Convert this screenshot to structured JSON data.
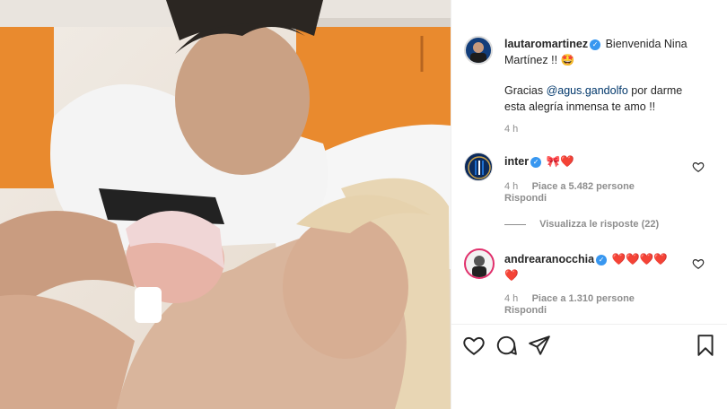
{
  "post": {
    "author": "lautaromartinez",
    "caption_line1": "Bienvenida Nina",
    "caption_line2": "Martínez !!",
    "caption_emoji": "🤩",
    "thanks_prefix": "Gracias",
    "mention": "@agus.gandolfo",
    "thanks_suffix": "por darme",
    "thanks_line2": "esta alegría inmensa te amo !!",
    "time": "4 h"
  },
  "comments": [
    {
      "username": "inter",
      "text": "🎀❤️",
      "time": "4 h",
      "likes": "Piace a 5.482 persone",
      "reply": "Rispondi",
      "view_replies": "Visualizza le risposte (22)"
    },
    {
      "username": "andrearanocchia",
      "text": "❤️❤️❤️❤️",
      "text_line2": "❤️",
      "time": "4 h",
      "likes": "Piace a 1.310 persone",
      "reply": "Rispondi"
    }
  ],
  "icons": {
    "like": "heart-icon",
    "comment": "comment-icon",
    "share": "share-icon",
    "save": "bookmark-icon"
  },
  "colors": {
    "verified": "#3897f0",
    "mention": "#00376b",
    "meta": "#8e8e8e"
  }
}
